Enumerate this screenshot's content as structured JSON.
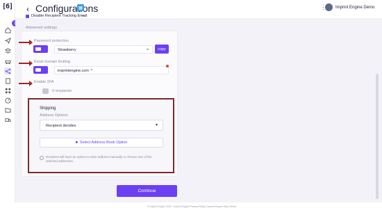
{
  "app": {
    "logo": "[6]"
  },
  "header": {
    "back_glyph": "‹",
    "title": "Configurations",
    "user_name": "Imprint Engine Demo"
  },
  "sidebar": {
    "badge": "3"
  },
  "settings": {
    "disable_tracking_label": "Disable Recipient Tracking Email",
    "advanced_label": "Advanced settings",
    "password_protection": {
      "label": "Password protection",
      "value": "Strawberry",
      "copy_label": "copy",
      "toggle_label": "ON"
    },
    "email_domain_limiting": {
      "label": "Email domain limiting",
      "domain_chip": "imprintengine.com",
      "toggle_label": "ON"
    },
    "enable_2fa": {
      "label": "Enable 2FA",
      "recipients_text": "0 recipients"
    }
  },
  "shipping": {
    "title": "Shipping",
    "address_options_label": "Address Options",
    "selected_option": "Recipient decides",
    "address_book_button": "Select Address Book Option",
    "note": "Recipient will have an option to enter address manually or choose one of the selected addresses."
  },
  "actions": {
    "continue_label": "Continue"
  },
  "footer": {
    "text": "© Imprint Engine 2023 · Imprint Engine Privacy Policy | Imprint Engine Help Center"
  },
  "colors": {
    "accent": "#6c3ff5",
    "annotation": "#a82121"
  }
}
